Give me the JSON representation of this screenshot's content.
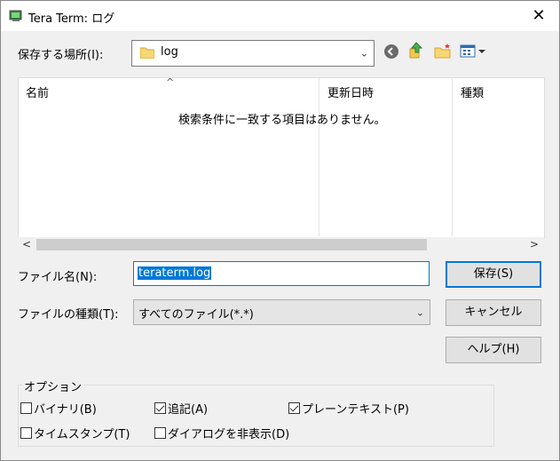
{
  "window": {
    "title": "Tera Term: ログ",
    "close_glyph": "✕"
  },
  "location": {
    "label": "保存する場所(I):",
    "folder": "log",
    "dropdown_arrow": "⌄"
  },
  "toolbar": {
    "icons": [
      "back-icon",
      "up-folder-icon",
      "new-folder-icon",
      "view-menu-icon"
    ],
    "accent": "#0078d7"
  },
  "list": {
    "columns": [
      "名前",
      "更新日時",
      "種類"
    ],
    "empty_message": "検索条件に一致する項目はありません。",
    "sort_indicator": "^"
  },
  "scroll": {
    "left": "<",
    "right": ">"
  },
  "filename": {
    "label": "ファイル名(N):",
    "value": "teraterm.log"
  },
  "filetype": {
    "label": "ファイルの種類(T):",
    "value": "すべてのファイル(*.*)"
  },
  "buttons": {
    "save": "保存(S)",
    "cancel": "キャンセル",
    "help": "ヘルプ(H)"
  },
  "options": {
    "title": "オプション",
    "binary": {
      "label": "バイナリ(B)",
      "checked": false
    },
    "append": {
      "label": "追記(A)",
      "checked": true
    },
    "plaintext": {
      "label": "プレーンテキスト(P)",
      "checked": true
    },
    "timestamp": {
      "label": "タイムスタンプ(T)",
      "checked": false
    },
    "hide_dialog": {
      "label": "ダイアログを非表示(D)",
      "checked": false
    }
  }
}
